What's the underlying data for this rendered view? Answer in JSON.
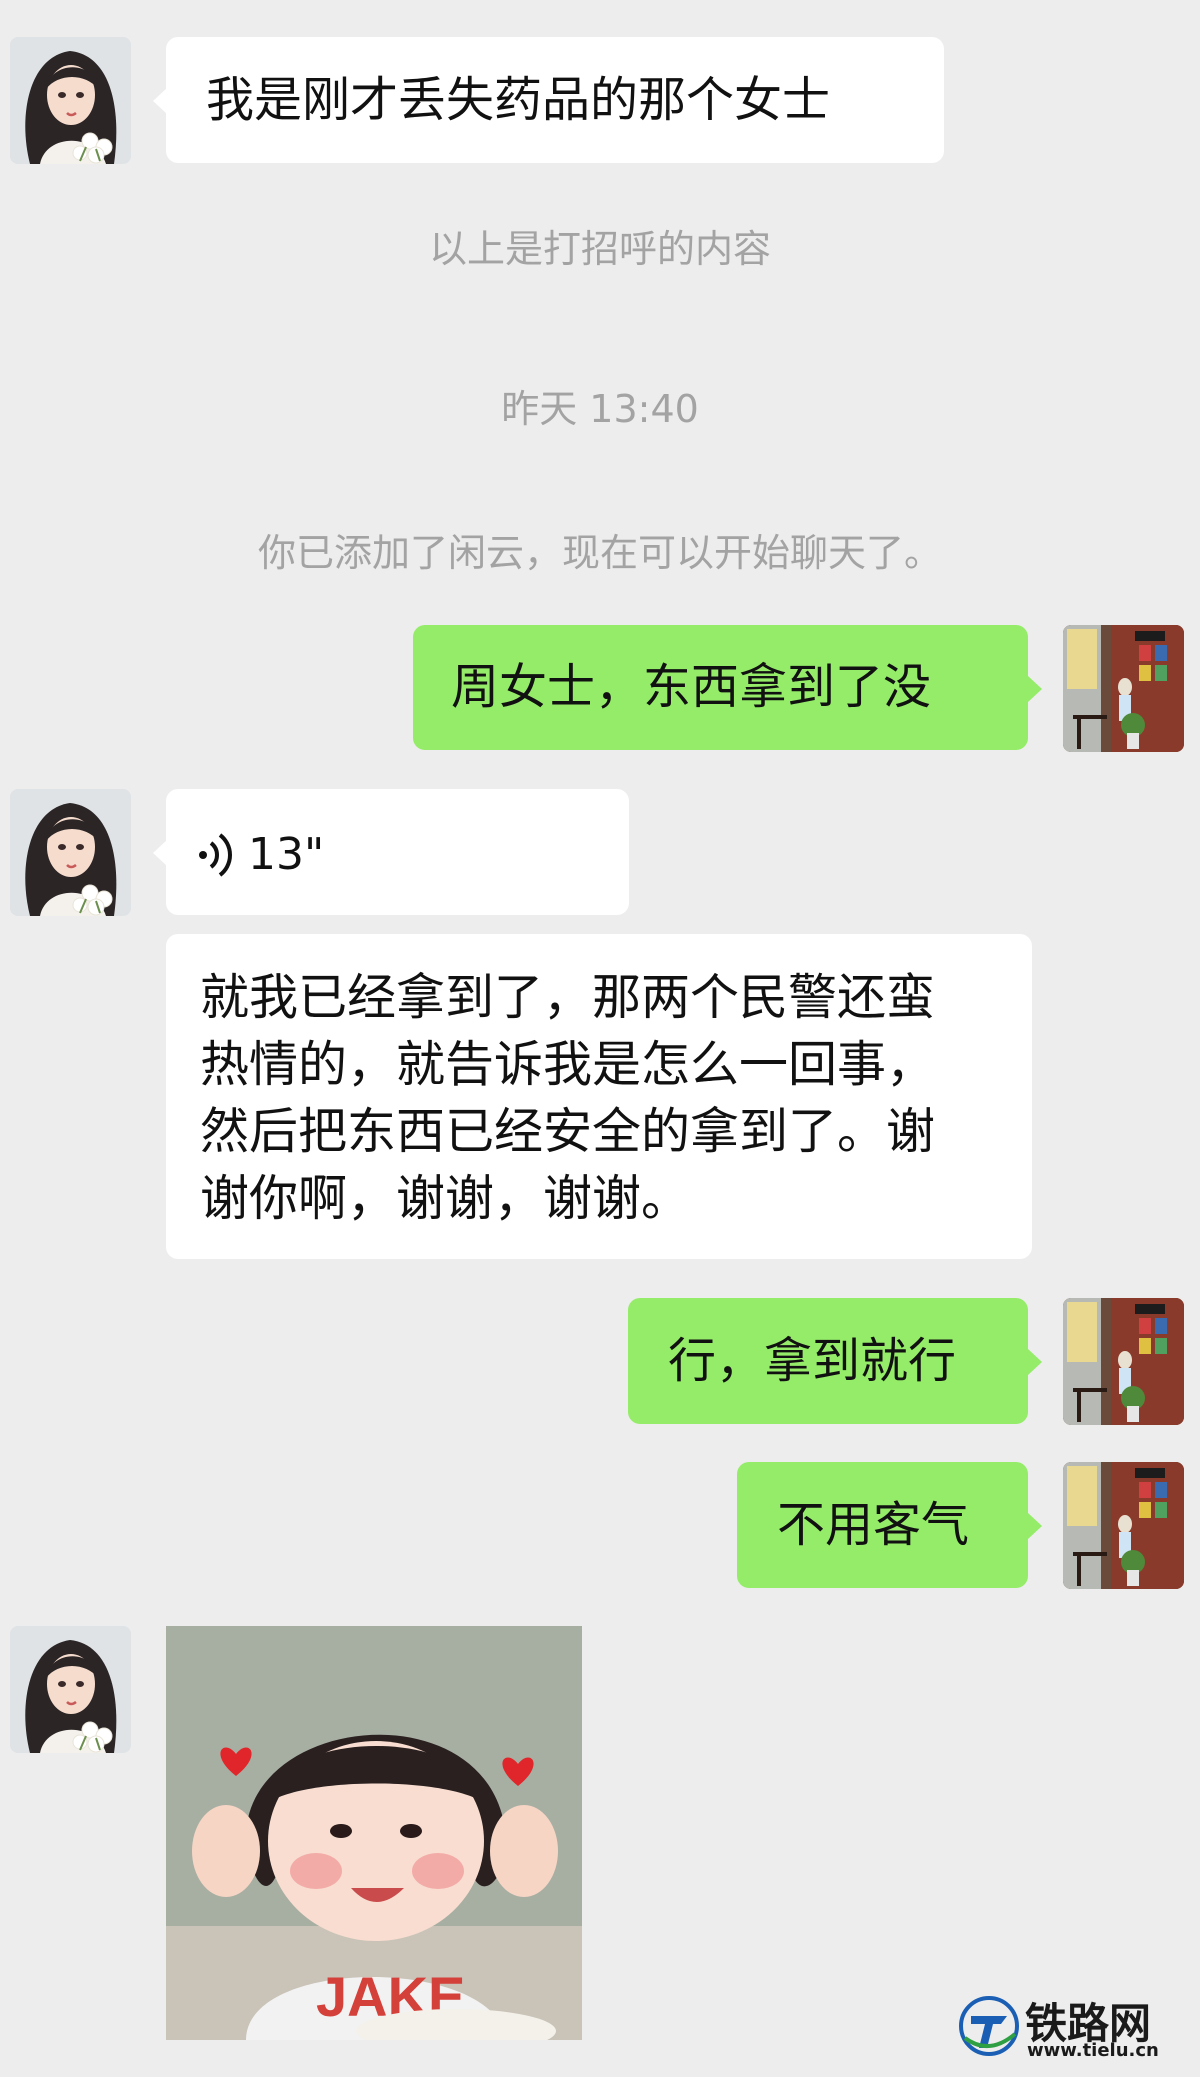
{
  "chat": {
    "messages": [
      {
        "side": "in",
        "text": "我是刚才丢失药品的那个女士"
      },
      {
        "side": "system",
        "text": "以上是打招呼的内容"
      },
      {
        "side": "system",
        "text": "昨天 13:40"
      },
      {
        "side": "system",
        "text": "你已添加了闲云，现在可以开始聊天了。"
      },
      {
        "side": "out",
        "text": "周女士，东西拿到了没"
      },
      {
        "side": "in",
        "type": "voice",
        "duration": "13\""
      },
      {
        "side": "in",
        "lines": [
          "就我已经拿到了，那两个民警还蛮",
          "热情的，就告诉我是怎么一回事，",
          "然后把东西已经安全的拿到了。谢",
          "谢你啊，谢谢，谢谢。"
        ]
      },
      {
        "side": "out",
        "text": "行，拿到就行"
      },
      {
        "side": "out",
        "text": "不用客气"
      },
      {
        "side": "in",
        "type": "sticker",
        "sticker_text": "JAKE"
      }
    ]
  },
  "watermark": {
    "name": "铁路网",
    "url": "www.tielu.cn"
  },
  "colors": {
    "background": "#ededed",
    "incoming": "#ffffff",
    "outgoing": "#95ec69",
    "system_text": "#a3a3a3",
    "watermark_blue": "#1a5fb4"
  }
}
